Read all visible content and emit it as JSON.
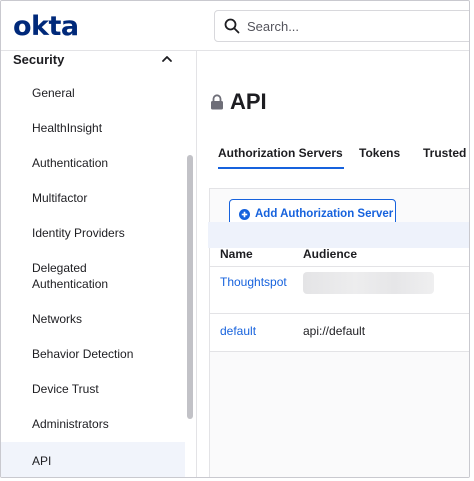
{
  "header": {
    "logo_text": "okta",
    "search_placeholder": "Search..."
  },
  "sidebar": {
    "section_label": "Security",
    "items": [
      {
        "label": "General"
      },
      {
        "label": "HealthInsight"
      },
      {
        "label": "Authentication"
      },
      {
        "label": "Multifactor"
      },
      {
        "label": "Identity Providers"
      },
      {
        "label": "Delegated Authentication"
      },
      {
        "label": "Networks"
      },
      {
        "label": "Behavior Detection"
      },
      {
        "label": "Device Trust"
      },
      {
        "label": "Administrators"
      },
      {
        "label": "API"
      }
    ],
    "active_item": "API"
  },
  "main": {
    "title": "API",
    "tabs": [
      {
        "label": "Authorization Servers",
        "active": true
      },
      {
        "label": "Tokens",
        "active": false
      },
      {
        "label": "Trusted O",
        "active": false
      }
    ],
    "add_button_label": "Add Authorization Server",
    "table": {
      "columns": [
        "Name",
        "Audience"
      ],
      "rows": [
        {
          "name": "Thoughtspot",
          "audience": ""
        },
        {
          "name": "default",
          "audience": "api://default"
        }
      ]
    }
  },
  "colors": {
    "brand": "#00297a",
    "accent": "#1662dd",
    "active_bg": "#f1f4fb"
  },
  "icons": {
    "search": "search-icon",
    "chevron": "chevron-up-icon",
    "lock": "lock-icon",
    "plus": "plus-circle-icon"
  }
}
